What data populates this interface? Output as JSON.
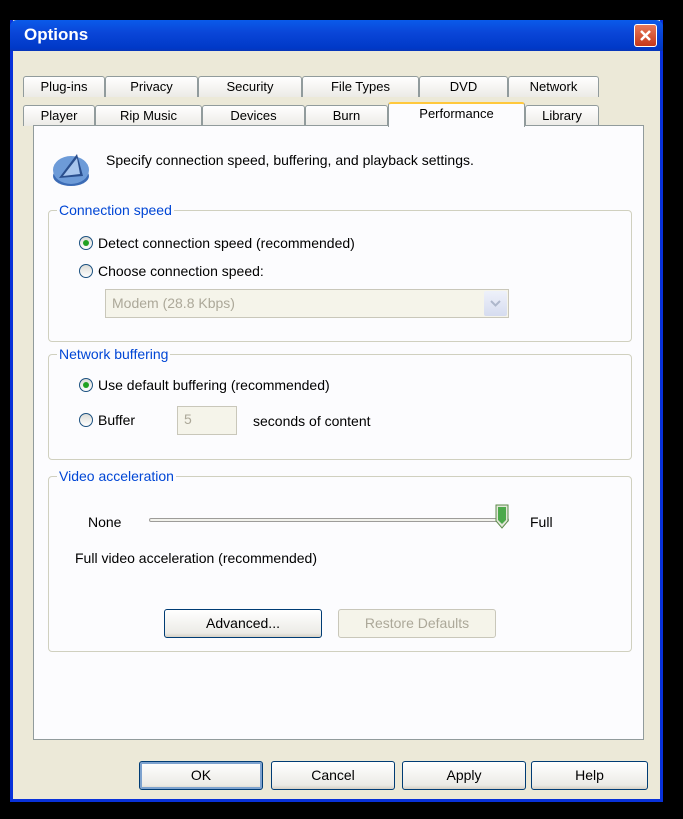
{
  "window": {
    "title": "Options"
  },
  "tabs": {
    "row1": [
      "Plug-ins",
      "Privacy",
      "Security",
      "File Types",
      "DVD",
      "Network"
    ],
    "row2": [
      "Player",
      "Rip Music",
      "Devices",
      "Burn",
      "Performance",
      "Library"
    ],
    "active": "Performance"
  },
  "header": {
    "text": "Specify connection speed, buffering, and playback settings."
  },
  "connection_speed": {
    "legend": "Connection speed",
    "option_detect": "Detect connection speed (recommended)",
    "option_choose": "Choose connection speed:",
    "selected": "detect",
    "speed_value": "Modem (28.8 Kbps)"
  },
  "network_buffering": {
    "legend": "Network buffering",
    "option_default": "Use default buffering (recommended)",
    "option_buffer": "Buffer",
    "buffer_value": "5",
    "suffix": "seconds of content",
    "selected": "default"
  },
  "video_acceleration": {
    "legend": "Video acceleration",
    "min_label": "None",
    "max_label": "Full",
    "level_fraction": 1.0,
    "status": "Full video acceleration (recommended)",
    "advanced_button": "Advanced...",
    "restore_button": "Restore Defaults"
  },
  "footer": {
    "ok": "OK",
    "cancel": "Cancel",
    "apply": "Apply",
    "help": "Help"
  },
  "colors": {
    "titlebar": "#0A46D8",
    "accent_tab": "#FFC83C",
    "legend_text": "#0046D5",
    "radio_dot": "#21A121"
  }
}
